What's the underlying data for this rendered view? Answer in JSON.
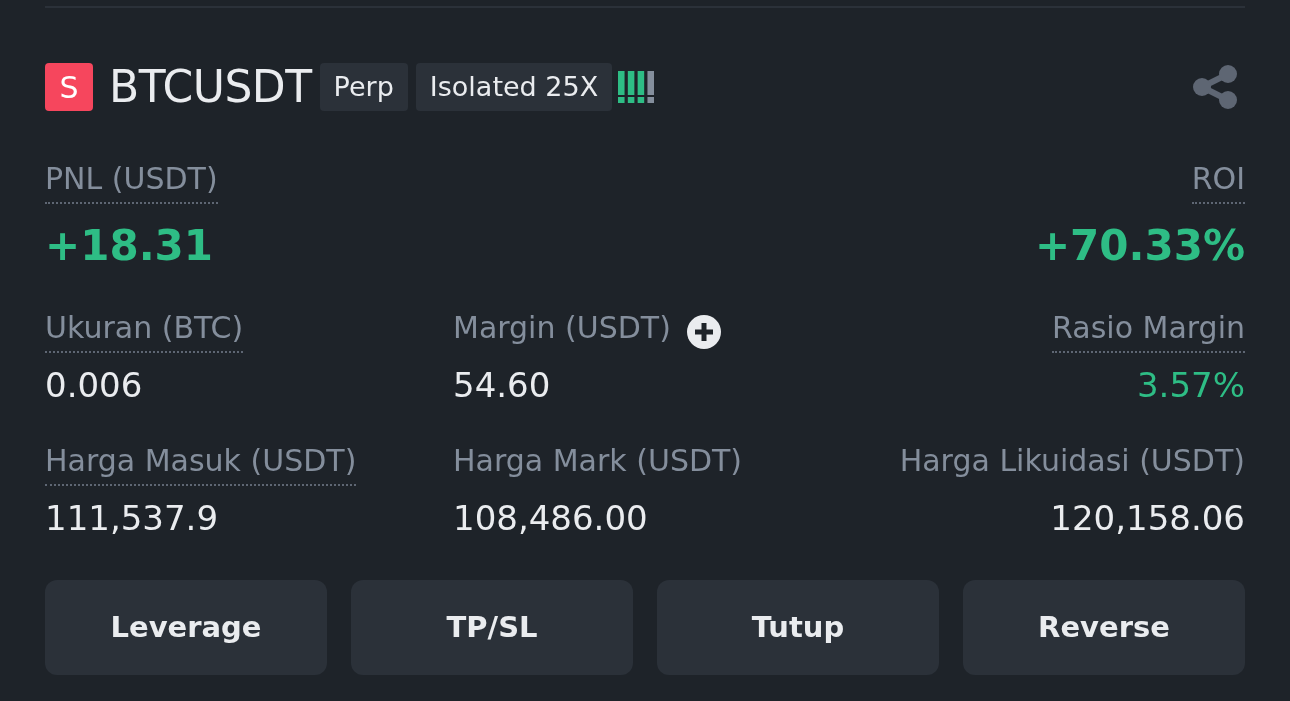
{
  "header": {
    "badge": "S",
    "symbol": "BTCUSDT",
    "tags": [
      "Perp",
      "Isolated 25X"
    ],
    "risk_meter": {
      "level": 0.75
    }
  },
  "summary": [
    {
      "label": "PNL (USDT)",
      "value": "+18.31",
      "underlined": true,
      "positive": true
    },
    {
      "label": "ROI",
      "value": "+70.33%",
      "underlined": true,
      "positive": true
    }
  ],
  "details": [
    {
      "label": "Ukuran (BTC)",
      "value": "0.006",
      "underlined": true,
      "positive": false
    },
    {
      "label": "Margin (USDT)",
      "value": "54.60",
      "underlined": false,
      "positive": false,
      "add_button": true
    },
    {
      "label": "Rasio Margin",
      "value": "3.57%",
      "underlined": true,
      "positive": true
    },
    {
      "label": "Harga Masuk (USDT)",
      "value": "111,537.9",
      "underlined": true,
      "positive": false
    },
    {
      "label": "Harga Mark (USDT)",
      "value": "108,486.00",
      "underlined": false,
      "positive": false
    },
    {
      "label": "Harga Likuidasi (USDT)",
      "value": "120,158.06",
      "underlined": false,
      "positive": false
    }
  ],
  "buttons": [
    "Leverage",
    "TP/SL",
    "Tutup",
    "Reverse"
  ]
}
